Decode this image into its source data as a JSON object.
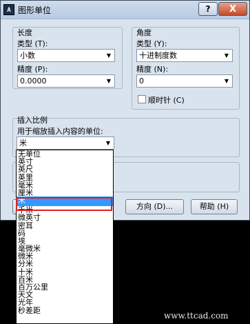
{
  "window": {
    "title": "图形单位",
    "icon_text": "A",
    "help_label": "?",
    "close_label": "X"
  },
  "length": {
    "section_label": "长度",
    "type_label": "类型 (T):",
    "type_value": "小数",
    "precision_label": "精度 (P):",
    "precision_value": "0.0000"
  },
  "angle": {
    "section_label": "角度",
    "type_label": "类型 (Y):",
    "type_value": "十进制度数",
    "precision_label": "精度 (N):",
    "precision_value": "0",
    "clockwise_label": "顺时针 (C)",
    "clockwise_checked": false
  },
  "insert": {
    "section_label": "插入比例",
    "units_label": "用于缩放插入内容的单位:",
    "units_value": "米"
  },
  "buttons": {
    "direction_label": "方向 (D)...",
    "help_label": "帮助 (H)"
  },
  "dropdown": {
    "items": [
      "无单位",
      "英寸",
      "英尺",
      "英里",
      "毫米",
      "厘米",
      "米",
      "千米",
      "微英寸",
      "密耳",
      "码",
      "埃",
      "毫微米",
      "微米",
      "分米",
      "十米",
      "百米",
      "百万公里",
      "天文",
      "光年",
      "秒差距"
    ],
    "selected_index": 6
  },
  "watermark": "www.ttcad.com",
  "colors": {
    "selection": "#3399ff",
    "highlight_border": "#e02020"
  }
}
